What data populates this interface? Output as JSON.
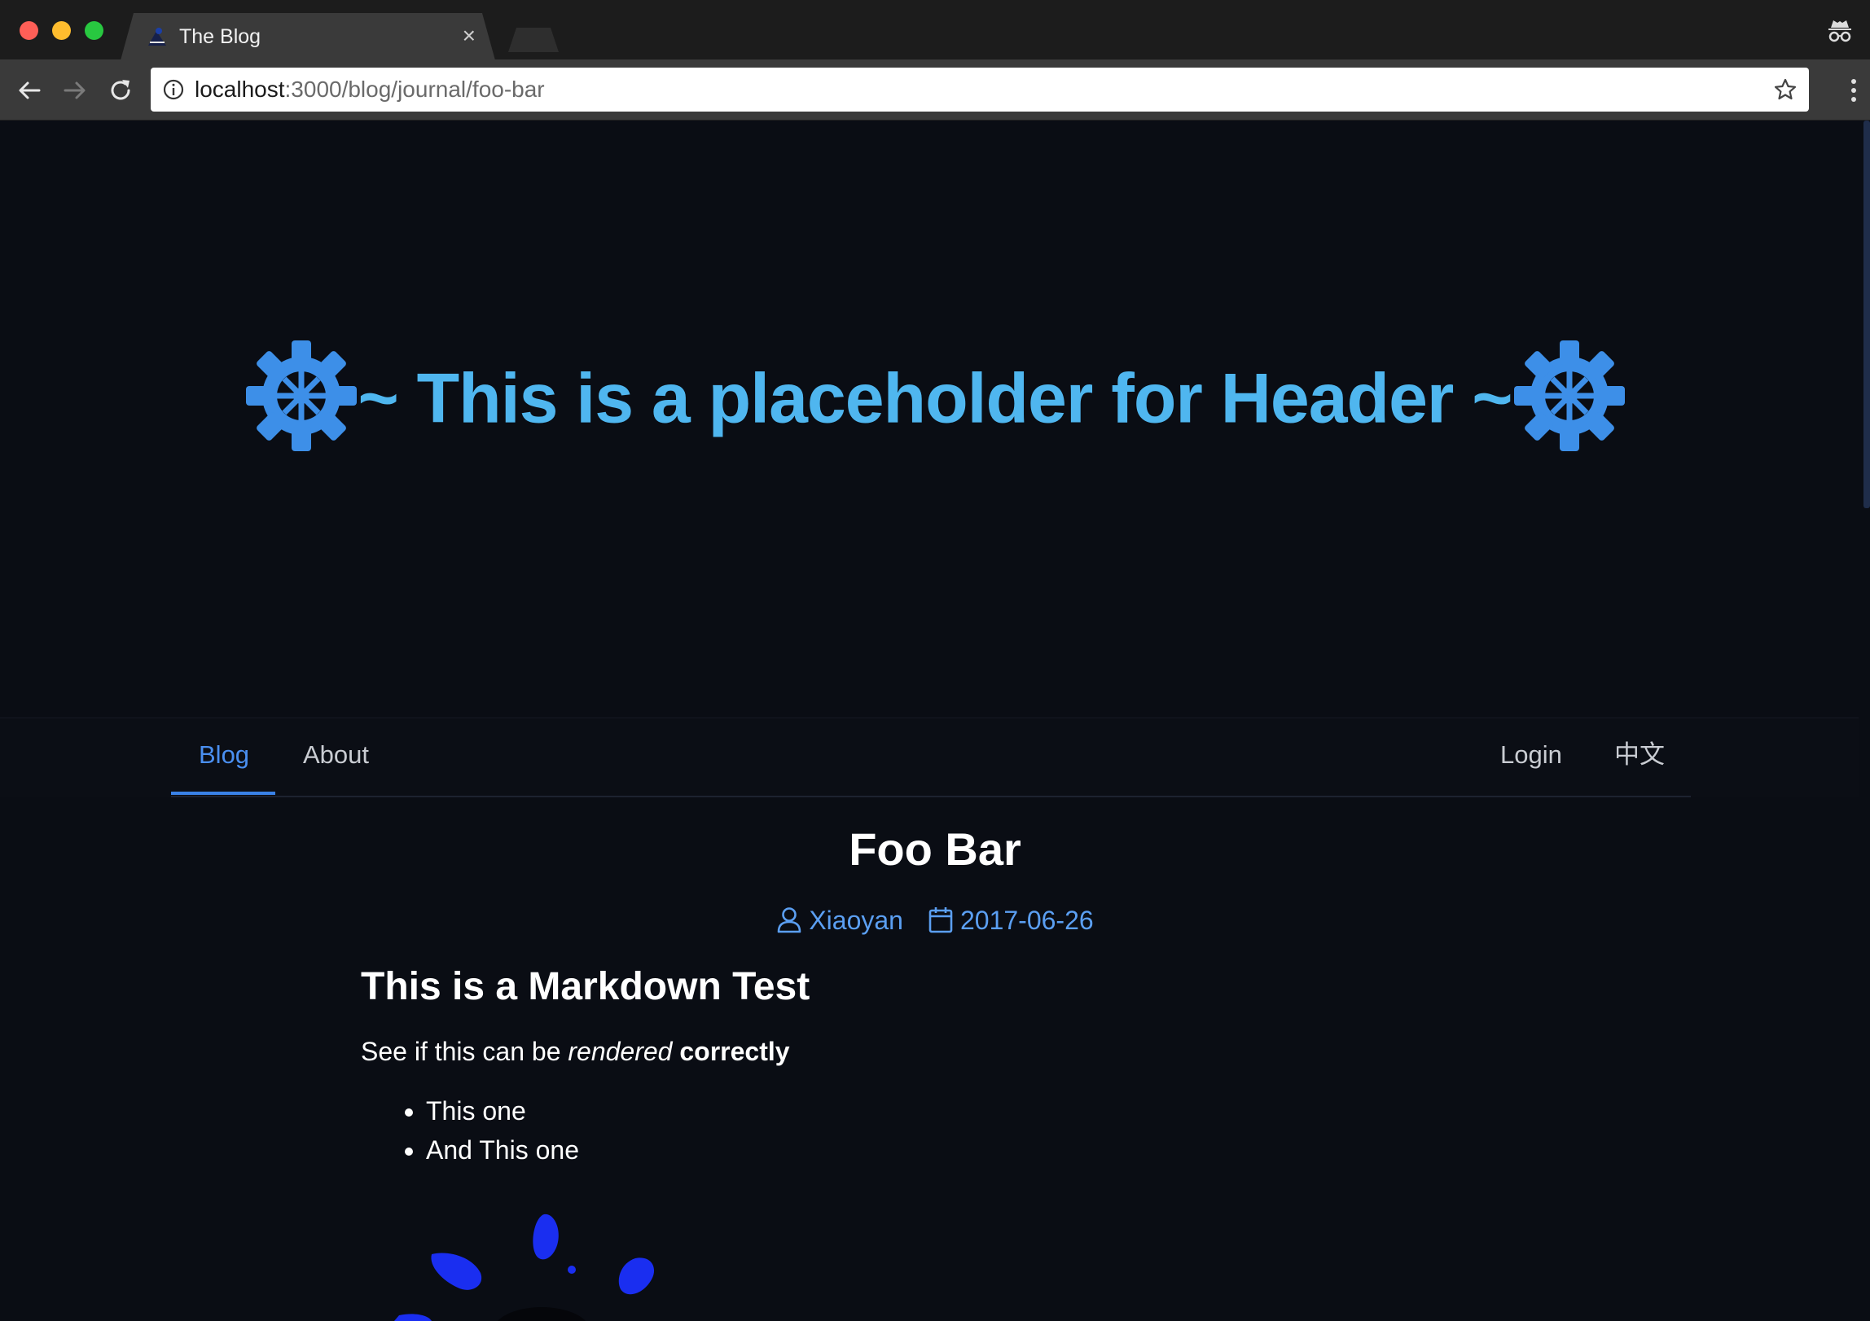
{
  "browser": {
    "tab_title": "The Blog",
    "tab_close": "×",
    "url_host": "localhost",
    "url_path": ":3000/blog/journal/foo-bar",
    "icons": [
      "back-icon",
      "forward-icon",
      "reload-icon",
      "info-icon",
      "star-icon",
      "menu-icon",
      "incognito-icon"
    ]
  },
  "hero": {
    "prefix": "~ ",
    "text": "This is a placeholder for Header",
    "suffix": " ~",
    "accent_color": "#4fb6ef",
    "gear_color": "#3d8fe8"
  },
  "nav": {
    "left": [
      "Blog",
      "About"
    ],
    "right": [
      "Login",
      "中文"
    ],
    "active": "Blog",
    "accent_color": "#4a8ff0"
  },
  "post": {
    "title": "Foo Bar",
    "author": "Xiaoyan",
    "date": "2017-06-26",
    "heading": "This is a Markdown Test",
    "para_before": "See if this can be ",
    "para_em": "rendered",
    "para_strong": "correctly",
    "list": [
      "This one",
      "And This one"
    ]
  }
}
